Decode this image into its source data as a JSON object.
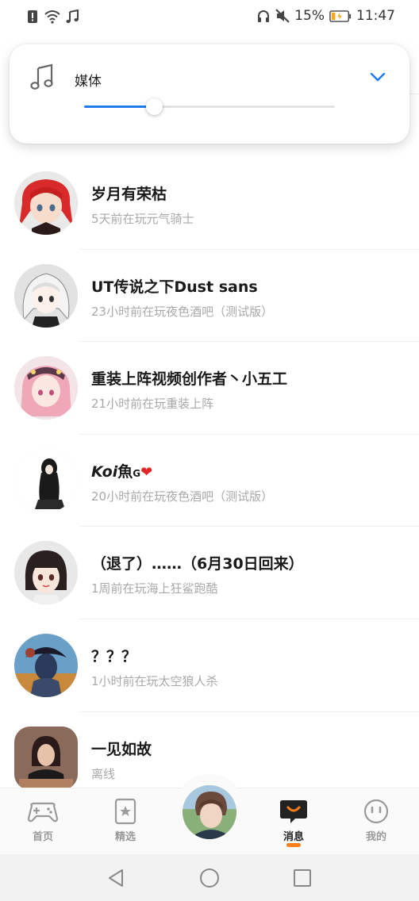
{
  "status_bar": {
    "battery_percent": "15%",
    "time": "11:47"
  },
  "volume_panel": {
    "label": "媒体",
    "level": 0.28,
    "accent_color": "#1e7cf0"
  },
  "friends": [
    {
      "name": "岁月有荣枯",
      "status": "5天前在玩元气骑士"
    },
    {
      "name": "UT传说之下Dust sans",
      "status": "23小时前在玩夜色酒吧（测试版）"
    },
    {
      "name": "重装上阵视频创作者丶小五工",
      "status": "21小时前在玩重装上阵"
    },
    {
      "name_part1": "Koi",
      "name_part2": "魚",
      "name_part3": "G",
      "name_heart": "❤",
      "status": "20小时前在玩夜色酒吧（测试版）"
    },
    {
      "name": "（退了）……（6月30日回来）",
      "status": "1周前在玩海上狂鲨跑酷"
    },
    {
      "name": "？？？",
      "status": "1小时前在玩太空狼人杀"
    },
    {
      "name": "一见如故",
      "status": "离线"
    }
  ],
  "bottom_nav": {
    "home": "首页",
    "featured": "精选",
    "messages": "消息",
    "mine": "我的",
    "active_color": "#ff7d1a"
  }
}
